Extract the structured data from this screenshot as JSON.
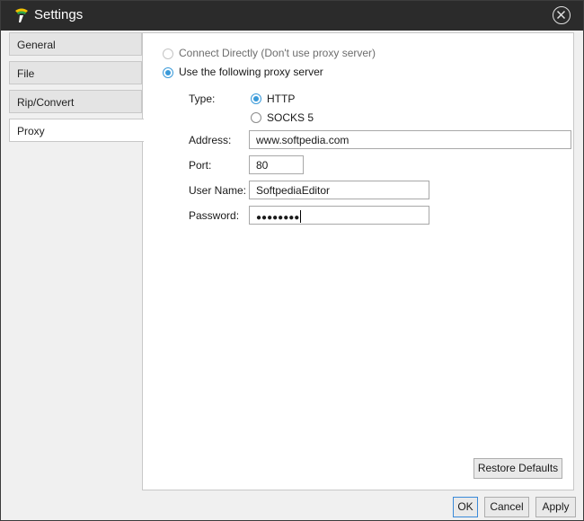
{
  "window": {
    "title": "Settings"
  },
  "sidebar": {
    "tabs": [
      {
        "label": "General"
      },
      {
        "label": "File"
      },
      {
        "label": "Rip/Convert"
      },
      {
        "label": "Proxy",
        "active": true
      }
    ]
  },
  "proxy": {
    "connection_options": [
      {
        "label": "Connect Directly (Don't use proxy server)",
        "selected": false,
        "enabled": false
      },
      {
        "label": "Use the following proxy server",
        "selected": true,
        "enabled": true
      }
    ],
    "type_label": "Type:",
    "type_options": [
      {
        "label": "HTTP",
        "selected": true
      },
      {
        "label": "SOCKS 5",
        "selected": false
      }
    ],
    "address_label": "Address:",
    "address_value": "www.softpedia.com",
    "port_label": "Port:",
    "port_value": "80",
    "username_label": "User Name:",
    "username_value": "SoftpediaEditor",
    "password_label": "Password:",
    "password_masked": "●●●●●●●●"
  },
  "buttons": {
    "restore_defaults": "Restore Defaults",
    "ok": "OK",
    "cancel": "Cancel",
    "apply": "Apply"
  },
  "colors": {
    "titlebar": "#2b2b2b",
    "accent": "#3a9ad9"
  }
}
